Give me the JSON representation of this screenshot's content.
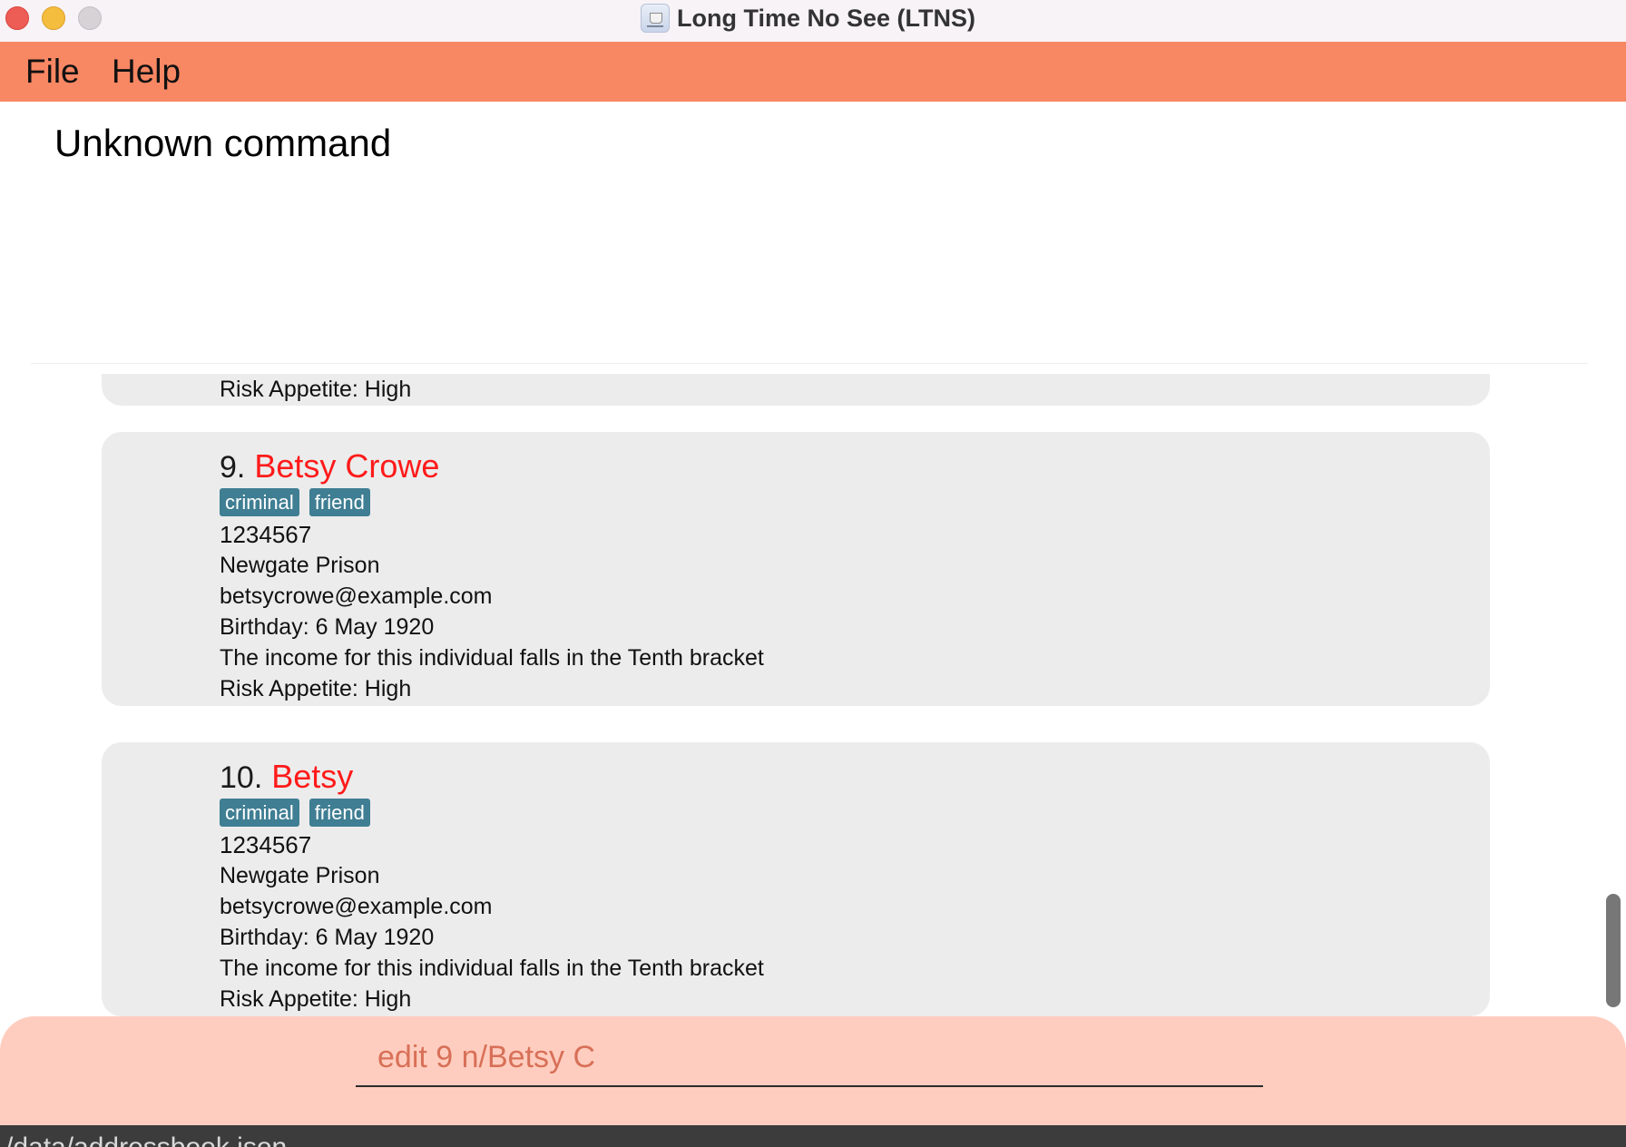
{
  "window": {
    "title": "Long Time No See (LTNS)"
  },
  "menu": {
    "file_label": "File",
    "help_label": "Help"
  },
  "result": {
    "message": "Unknown command"
  },
  "person_list": {
    "partial_card": {
      "risk": "Risk Appetite: High"
    },
    "cards": [
      {
        "index": "9.",
        "name": "Betsy Crowe",
        "tags": [
          "criminal",
          "friend"
        ],
        "phone": "1234567",
        "address": "Newgate Prison",
        "email": "betsycrowe@example.com",
        "birthday": "Birthday: 6 May 1920",
        "income": "The income for this individual falls in the Tenth bracket",
        "risk": "Risk Appetite: High"
      },
      {
        "index": "10.",
        "name": "Betsy",
        "tags": [
          "criminal",
          "friend"
        ],
        "phone": "1234567",
        "address": "Newgate Prison",
        "email": "betsycrowe@example.com",
        "birthday": "Birthday: 6 May 1920",
        "income": "The income for this individual falls in the Tenth bracket",
        "risk": "Risk Appetite: High"
      }
    ]
  },
  "command": {
    "value": "edit 9 n/Betsy C"
  },
  "status_bar": {
    "file_path": "/data/addressbook.json"
  },
  "colors": {
    "menu_bar": "#f88763",
    "name_red": "#ff1a1a",
    "tag_bg": "#3f7e93",
    "command_area": "#ffcdbf",
    "command_text": "#d87058"
  }
}
